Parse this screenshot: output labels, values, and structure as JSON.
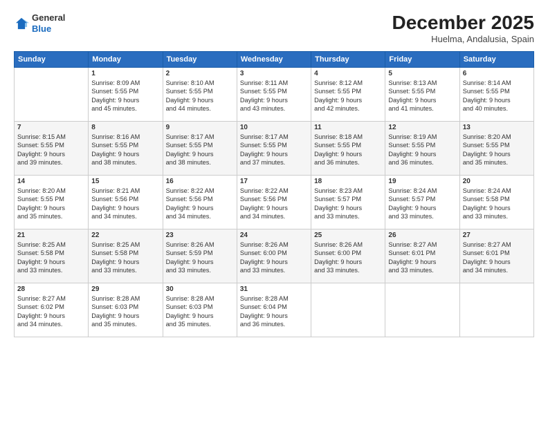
{
  "header": {
    "logo_general": "General",
    "logo_blue": "Blue",
    "month_title": "December 2025",
    "subtitle": "Huelma, Andalusia, Spain"
  },
  "days_of_week": [
    "Sunday",
    "Monday",
    "Tuesday",
    "Wednesday",
    "Thursday",
    "Friday",
    "Saturday"
  ],
  "weeks": [
    [
      {
        "day": "",
        "data": ""
      },
      {
        "day": "1",
        "data": "Sunrise: 8:09 AM\nSunset: 5:55 PM\nDaylight: 9 hours\nand 45 minutes."
      },
      {
        "day": "2",
        "data": "Sunrise: 8:10 AM\nSunset: 5:55 PM\nDaylight: 9 hours\nand 44 minutes."
      },
      {
        "day": "3",
        "data": "Sunrise: 8:11 AM\nSunset: 5:55 PM\nDaylight: 9 hours\nand 43 minutes."
      },
      {
        "day": "4",
        "data": "Sunrise: 8:12 AM\nSunset: 5:55 PM\nDaylight: 9 hours\nand 42 minutes."
      },
      {
        "day": "5",
        "data": "Sunrise: 8:13 AM\nSunset: 5:55 PM\nDaylight: 9 hours\nand 41 minutes."
      },
      {
        "day": "6",
        "data": "Sunrise: 8:14 AM\nSunset: 5:55 PM\nDaylight: 9 hours\nand 40 minutes."
      }
    ],
    [
      {
        "day": "7",
        "data": "Sunrise: 8:15 AM\nSunset: 5:55 PM\nDaylight: 9 hours\nand 39 minutes."
      },
      {
        "day": "8",
        "data": "Sunrise: 8:16 AM\nSunset: 5:55 PM\nDaylight: 9 hours\nand 38 minutes."
      },
      {
        "day": "9",
        "data": "Sunrise: 8:17 AM\nSunset: 5:55 PM\nDaylight: 9 hours\nand 38 minutes."
      },
      {
        "day": "10",
        "data": "Sunrise: 8:17 AM\nSunset: 5:55 PM\nDaylight: 9 hours\nand 37 minutes."
      },
      {
        "day": "11",
        "data": "Sunrise: 8:18 AM\nSunset: 5:55 PM\nDaylight: 9 hours\nand 36 minutes."
      },
      {
        "day": "12",
        "data": "Sunrise: 8:19 AM\nSunset: 5:55 PM\nDaylight: 9 hours\nand 36 minutes."
      },
      {
        "day": "13",
        "data": "Sunrise: 8:20 AM\nSunset: 5:55 PM\nDaylight: 9 hours\nand 35 minutes."
      }
    ],
    [
      {
        "day": "14",
        "data": "Sunrise: 8:20 AM\nSunset: 5:55 PM\nDaylight: 9 hours\nand 35 minutes."
      },
      {
        "day": "15",
        "data": "Sunrise: 8:21 AM\nSunset: 5:56 PM\nDaylight: 9 hours\nand 34 minutes."
      },
      {
        "day": "16",
        "data": "Sunrise: 8:22 AM\nSunset: 5:56 PM\nDaylight: 9 hours\nand 34 minutes."
      },
      {
        "day": "17",
        "data": "Sunrise: 8:22 AM\nSunset: 5:56 PM\nDaylight: 9 hours\nand 34 minutes."
      },
      {
        "day": "18",
        "data": "Sunrise: 8:23 AM\nSunset: 5:57 PM\nDaylight: 9 hours\nand 33 minutes."
      },
      {
        "day": "19",
        "data": "Sunrise: 8:24 AM\nSunset: 5:57 PM\nDaylight: 9 hours\nand 33 minutes."
      },
      {
        "day": "20",
        "data": "Sunrise: 8:24 AM\nSunset: 5:58 PM\nDaylight: 9 hours\nand 33 minutes."
      }
    ],
    [
      {
        "day": "21",
        "data": "Sunrise: 8:25 AM\nSunset: 5:58 PM\nDaylight: 9 hours\nand 33 minutes."
      },
      {
        "day": "22",
        "data": "Sunrise: 8:25 AM\nSunset: 5:58 PM\nDaylight: 9 hours\nand 33 minutes."
      },
      {
        "day": "23",
        "data": "Sunrise: 8:26 AM\nSunset: 5:59 PM\nDaylight: 9 hours\nand 33 minutes."
      },
      {
        "day": "24",
        "data": "Sunrise: 8:26 AM\nSunset: 6:00 PM\nDaylight: 9 hours\nand 33 minutes."
      },
      {
        "day": "25",
        "data": "Sunrise: 8:26 AM\nSunset: 6:00 PM\nDaylight: 9 hours\nand 33 minutes."
      },
      {
        "day": "26",
        "data": "Sunrise: 8:27 AM\nSunset: 6:01 PM\nDaylight: 9 hours\nand 33 minutes."
      },
      {
        "day": "27",
        "data": "Sunrise: 8:27 AM\nSunset: 6:01 PM\nDaylight: 9 hours\nand 34 minutes."
      }
    ],
    [
      {
        "day": "28",
        "data": "Sunrise: 8:27 AM\nSunset: 6:02 PM\nDaylight: 9 hours\nand 34 minutes."
      },
      {
        "day": "29",
        "data": "Sunrise: 8:28 AM\nSunset: 6:03 PM\nDaylight: 9 hours\nand 35 minutes."
      },
      {
        "day": "30",
        "data": "Sunrise: 8:28 AM\nSunset: 6:03 PM\nDaylight: 9 hours\nand 35 minutes."
      },
      {
        "day": "31",
        "data": "Sunrise: 8:28 AM\nSunset: 6:04 PM\nDaylight: 9 hours\nand 36 minutes."
      },
      {
        "day": "",
        "data": ""
      },
      {
        "day": "",
        "data": ""
      },
      {
        "day": "",
        "data": ""
      }
    ]
  ]
}
